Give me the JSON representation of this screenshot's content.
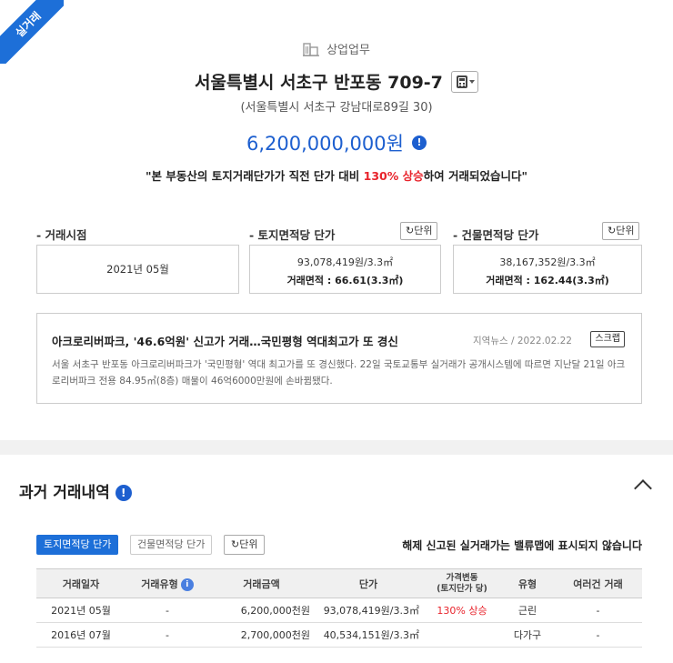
{
  "ribbon": "실거래",
  "category": {
    "icon": "building-icon",
    "label": "상업업무"
  },
  "address": {
    "lot": "서울특별시 서초구 반포동 709-7",
    "road": "(서울특별시 서초구 강남대로89길 30)",
    "calc_icon": "calculator-icon"
  },
  "price": {
    "value": "6,200,000,000원"
  },
  "quote": {
    "before": "\"본 부동산의 토지거래단가가 직전 단가 대비 ",
    "highlight": "130% 상승",
    "after": "하여 거래되었습니다\""
  },
  "metrics": {
    "date": {
      "label": "- 거래시점",
      "value": "2021년 05월"
    },
    "land": {
      "label": "- 토지면적당 단가",
      "unit_btn": "단위",
      "price": "93,078,419원/3.3㎡",
      "area": "거래면적 : 66.61(3.3㎡)"
    },
    "building": {
      "label": "- 건물면적당 단가",
      "unit_btn": "단위",
      "price": "38,167,352원/3.3㎡",
      "area": "거래면적 : 162.44(3.3㎡)"
    }
  },
  "news": {
    "title": "아크로리버파크, '46.6억원' 신고가 거래…국민평형 역대최고가 또 경신",
    "meta": "지역뉴스  /  2022.02.22",
    "scrap": "스크랩",
    "body": "서울 서초구 반포동 아크로리버파크가 '국민평형' 역대 최고가를 또 경신했다. 22일 국토교통부 실거래가 공개시스템에 따르면 지난달 21일 아크로리버파크 전용 84.95㎡(8층) 매물이 46억6000만원에 손바뀜됐다."
  },
  "history": {
    "title": "과거 거래내역",
    "tabs": {
      "land": "토지면적당 단가",
      "building": "건물면적당 단가",
      "unit": "단위"
    },
    "notice": "해제 신고된 실거래가는 밸류맵에 표시되지 않습니다",
    "headers": {
      "date": "거래일자",
      "type": "거래유형",
      "amount": "거래금액",
      "unit_price": "단가",
      "change_l1": "가격변동",
      "change_l2": "(토지단가 당)",
      "kind": "유형",
      "multi": "여러건 거래"
    },
    "rows": [
      {
        "date": "2021년 05월",
        "type": "-",
        "amount": "6,200,000천원",
        "unit_price": "93,078,419원/3.3㎡",
        "change": "130% 상승",
        "kind": "근린",
        "multi": "-"
      },
      {
        "date": "2016년 07월",
        "type": "-",
        "amount": "2,700,000천원",
        "unit_price": "40,534,151원/3.3㎡",
        "change": "",
        "kind": "다가구",
        "multi": "-"
      }
    ]
  },
  "colors": {
    "accent": "#1d6fd8",
    "price": "#1d5fcf",
    "highlight": "#e8242c"
  }
}
